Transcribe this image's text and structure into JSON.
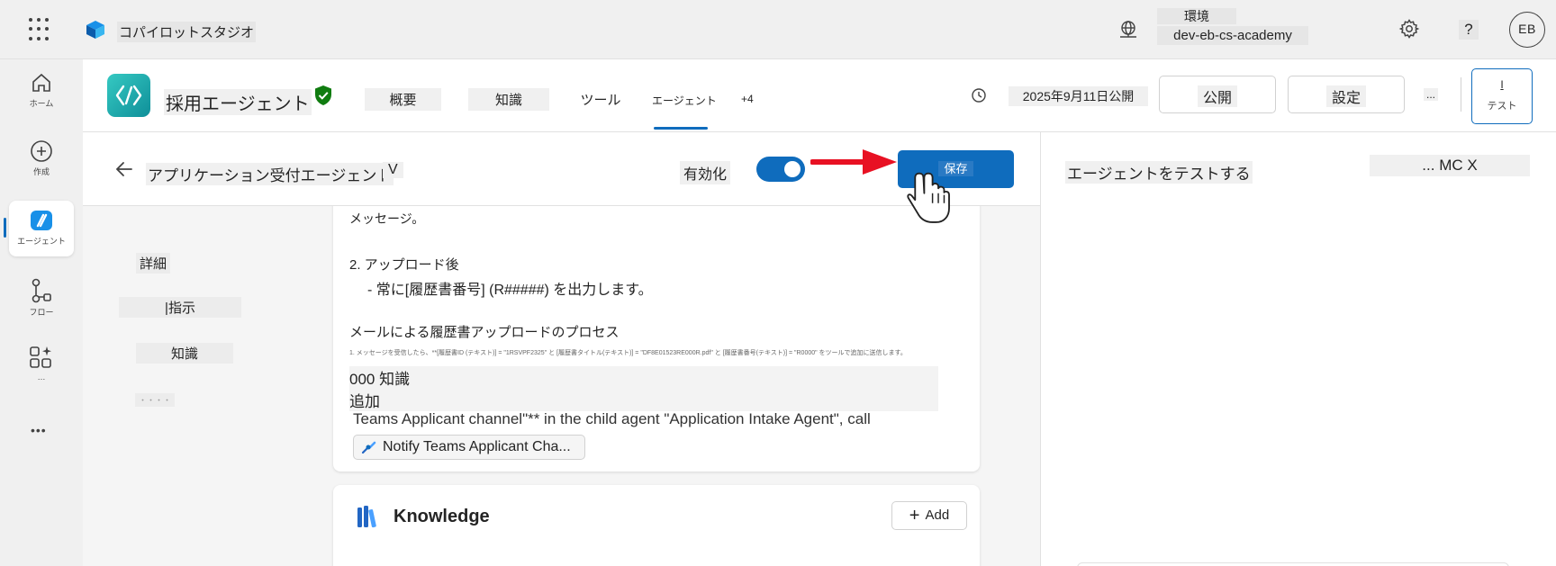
{
  "topbar": {
    "app_name": "コパイロットスタジオ",
    "env_label": "環境",
    "env_value": "dev-eb-cs-academy",
    "help": "?",
    "avatar_initials": "EB"
  },
  "rail": {
    "home": "ホーム",
    "create": "作成",
    "agents": "エージェント",
    "flows": "フロー",
    "more_label": "…",
    "overflow": "•••"
  },
  "agent": {
    "name": "採用エージェント",
    "tabs": [
      "概要",
      "知識",
      "ツール",
      "エージェント",
      "+4"
    ],
    "published": "2025年9月11日公開",
    "publish_btn": "公開",
    "settings_btn": "設定",
    "more": "...",
    "test_btn_icon": "I",
    "test_btn": "テスト"
  },
  "child": {
    "name": "アプリケーション受付エージェント",
    "version": "V",
    "enable_label": "有効化",
    "enabled": true,
    "save_btn": "保存"
  },
  "left_nav": [
    "詳細",
    "|指示",
    "知識",
    "・・・・"
  ],
  "instructions": {
    "line1": "メッセージ。",
    "line2": "2. アップロード後",
    "line3": "- 常に[履歴書番号] (R#####) を出力します。",
    "line4": "メールによる履歴書アップロードのプロセス",
    "line5": "1. メッセージを受信したら、**[履歴書ID (テキスト)] = \"1RSVPF2325\" と [履歴書タイトル(テキスト)] = \"DF8E01523RE000R.pdf\" と [履歴書番号(テキスト)] = \"R0000\" をツールで追加に送信します。",
    "line6": "000 知識",
    "line7": "追加",
    "line8": "Teams Applicant channel\"** in the child agent \"Application Intake Agent\", call",
    "chip": "Notify Teams Applicant Cha..."
  },
  "knowledge": {
    "title": "Knowledge",
    "add": "Add"
  },
  "test_pane": {
    "title": "エージェントをテストする",
    "actions": "... MC X"
  }
}
